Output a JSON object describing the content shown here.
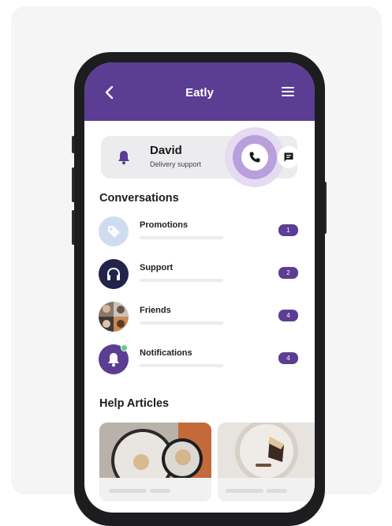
{
  "app": {
    "title": "Eatly",
    "accent": "#5b3d93"
  },
  "contact": {
    "name": "David",
    "role": "Delivery support",
    "icons": [
      "bell-icon",
      "phone-icon",
      "chat-icon"
    ]
  },
  "conversations": {
    "heading": "Conversations",
    "items": [
      {
        "label": "Promotions",
        "count": "1",
        "icon": "tag-icon"
      },
      {
        "label": "Support",
        "count": "2",
        "icon": "headset-icon"
      },
      {
        "label": "Friends",
        "count": "4",
        "icon": "group-photo"
      },
      {
        "label": "Notifications",
        "count": "4",
        "icon": "bell-icon"
      }
    ]
  },
  "help": {
    "heading": "Help Articles"
  }
}
